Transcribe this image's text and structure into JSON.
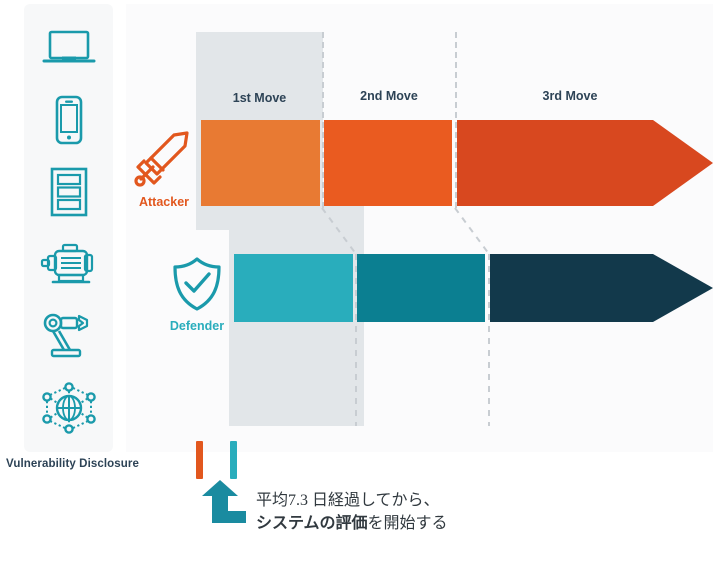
{
  "sidebar": {
    "name": "asset-rail",
    "caption": "Vulnerability Disclosure",
    "icons": [
      {
        "name": "laptop-icon",
        "label": "laptop"
      },
      {
        "name": "smartphone-icon",
        "label": "smartphone"
      },
      {
        "name": "server-rack-icon",
        "label": "server rack"
      },
      {
        "name": "industrial-motor-icon",
        "label": "industrial motor"
      },
      {
        "name": "robot-arm-icon",
        "label": "robot arm"
      },
      {
        "name": "iot-network-icon",
        "label": "iot network"
      }
    ]
  },
  "chart_data": {
    "type": "bar",
    "title": "",
    "categories": [
      "1st Move",
      "2nd Move",
      "3rd Move"
    ],
    "series": [
      {
        "name": "Attacker",
        "color": "#e87a33",
        "values": [
          1,
          1,
          1
        ],
        "segment_colors": [
          "#e87a33",
          "#ea5b20",
          "#d8481f"
        ]
      },
      {
        "name": "Defender",
        "color": "#29adbc",
        "values": [
          1,
          1,
          1
        ],
        "segment_colors": [
          "#29adbc",
          "#0b7f91",
          "#12394b"
        ]
      }
    ],
    "highlight_category": "1st Move",
    "legend": "none",
    "grid": false,
    "annotation": {
      "line1": "平均7.3 日経過してから、",
      "line2_bold": "システムの評価",
      "line2_rest": "を開始する",
      "value": 7.3,
      "unit": "日"
    }
  },
  "moves": {
    "m1": "1st Move",
    "m2": "2nd Move",
    "m3": "3rd Move"
  },
  "roles": {
    "attacker": {
      "label": "Attacker",
      "icon": "sword-icon",
      "color": "#e2571e"
    },
    "defender": {
      "label": "Defender",
      "icon": "shield-check-icon",
      "color": "#29adbc"
    }
  },
  "colors": {
    "attack_1": "#e87a33",
    "attack_2": "#ea5b20",
    "attack_3": "#d8481f",
    "defend_1": "#29adbc",
    "defend_2": "#0b7f91",
    "defend_3": "#12394b",
    "highlight": "#e2e6e9",
    "panel": "#fbfbfc",
    "text_dark": "#2d4356"
  },
  "annotation": {
    "line1": "平均7.3 日経過してから、",
    "line2_bold": "システムの評価",
    "line2_rest": "を開始する",
    "tick_attacker_color": "#e2571e",
    "tick_defender_color": "#29adbc"
  }
}
